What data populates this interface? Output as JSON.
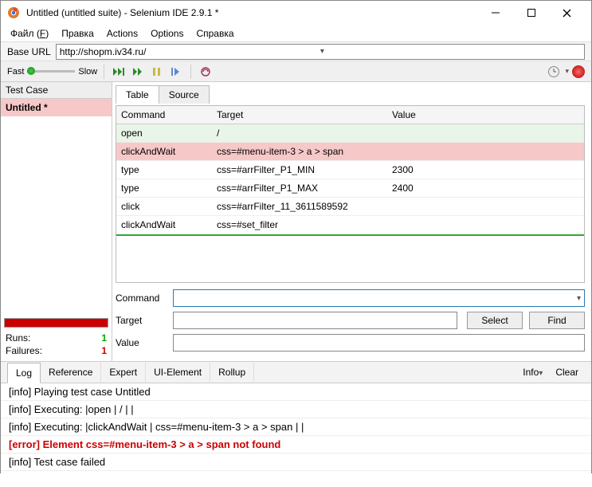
{
  "window": {
    "title": "Untitled (untitled suite) - Selenium IDE 2.9.1 *"
  },
  "menu": {
    "file": "Файл",
    "file_hotkey": "F",
    "edit": "Правка",
    "actions": "Actions",
    "options": "Options",
    "help": "Справка"
  },
  "baseurl": {
    "label": "Base URL",
    "value": "http://shopm.iv34.ru/"
  },
  "toolbar": {
    "fast": "Fast",
    "slow": "Slow"
  },
  "testcases": {
    "header": "Test Case",
    "items": [
      {
        "label": "Untitled *"
      }
    ]
  },
  "stats": {
    "runs_label": "Runs:",
    "runs_value": "1",
    "failures_label": "Failures:",
    "failures_value": "1"
  },
  "righttabs": {
    "table": "Table",
    "source": "Source"
  },
  "cmdheader": {
    "command": "Command",
    "target": "Target",
    "value": "Value"
  },
  "commands": [
    {
      "cmd": "open",
      "target": "/",
      "value": ""
    },
    {
      "cmd": "clickAndWait",
      "target": "css=#menu-item-3 > a > span",
      "value": ""
    },
    {
      "cmd": "type",
      "target": "css=#arrFilter_P1_MIN",
      "value": "2300"
    },
    {
      "cmd": "type",
      "target": "css=#arrFilter_P1_MAX",
      "value": "2400"
    },
    {
      "cmd": "click",
      "target": "css=#arrFilter_11_3611589592",
      "value": ""
    },
    {
      "cmd": "clickAndWait",
      "target": "css=#set_filter",
      "value": ""
    }
  ],
  "fields": {
    "command_label": "Command",
    "command_value": "",
    "target_label": "Target",
    "target_value": "",
    "value_label": "Value",
    "value_value": "",
    "select_btn": "Select",
    "find_btn": "Find"
  },
  "bottomtabs": {
    "log": "Log",
    "reference": "Reference",
    "expert": "Expert",
    "ui": "UI-Element",
    "rollup": "Rollup",
    "info": "Info",
    "clear": "Clear"
  },
  "log": [
    {
      "text": "[info] Playing test case Untitled",
      "cls": ""
    },
    {
      "text": "[info] Executing: |open | / | |",
      "cls": ""
    },
    {
      "text": "[info] Executing: |clickAndWait | css=#menu-item-3 > a > span | |",
      "cls": ""
    },
    {
      "text": "[error] Element css=#menu-item-3 > a > span not found",
      "cls": "error"
    },
    {
      "text": "[info] Test case failed",
      "cls": ""
    }
  ]
}
